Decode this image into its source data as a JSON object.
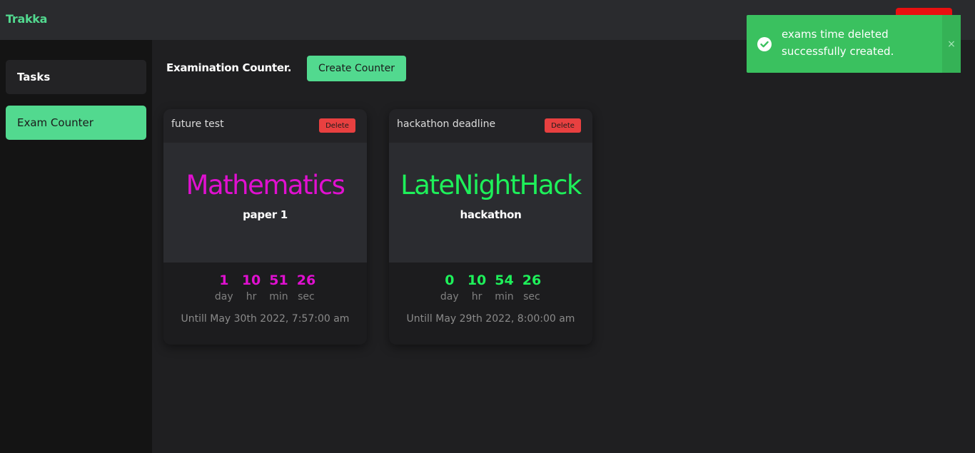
{
  "app": {
    "brand": "Trakka"
  },
  "colors": {
    "accent": "#52d98f",
    "danger": "#e84040",
    "card1_accent": "#e010d0",
    "card2_accent": "#1ef05a",
    "toast_bg": "#3ac15f"
  },
  "sidebar": {
    "items": [
      {
        "label": "Tasks"
      },
      {
        "label": "Exam Counter"
      }
    ]
  },
  "main": {
    "title": "Examination Counter.",
    "create_label": "Create Counter"
  },
  "cards": [
    {
      "name": "future test",
      "delete_label": "Delete",
      "subject": "Mathematics",
      "type": "paper 1",
      "days": "1",
      "hours": "10",
      "minutes": "51",
      "seconds": "26",
      "day_label": "day",
      "hr_label": "hr",
      "min_label": "min",
      "sec_label": "sec",
      "until": "Untill May 30th 2022, 7:57:00 am"
    },
    {
      "name": "hackathon deadline",
      "delete_label": "Delete",
      "subject": "LateNightHack",
      "type": "hackathon",
      "days": "0",
      "hours": "10",
      "minutes": "54",
      "seconds": "26",
      "day_label": "day",
      "hr_label": "hr",
      "min_label": "min",
      "sec_label": "sec",
      "until": "Untill May 29th 2022, 8:00:00 am"
    }
  ],
  "toast": {
    "message": "exams time deleted successfully created.",
    "close": "×",
    "icon": "check-circle-icon"
  }
}
